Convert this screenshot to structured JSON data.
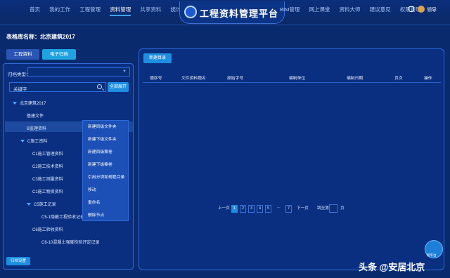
{
  "header": {
    "nav_left": [
      "首页",
      "我的工作",
      "工程管理",
      "资料管理",
      "共享资料",
      "统计分析"
    ],
    "active_index": 3,
    "app_title": "工程资料管理平台",
    "nav_right": [
      "BIM管理",
      "网上课堂",
      "资料大师",
      "建议意见",
      "权限管理"
    ],
    "user_name": "领导"
  },
  "form": {
    "form_lib_label": "表格库名称：北京建筑2017",
    "tabs": [
      "工程资料",
      "电子归档"
    ]
  },
  "left": {
    "archive_type_label": "归档类型：",
    "keyword_label": "关键字",
    "expand_all": "全部展开",
    "tree": [
      {
        "label": "北京建筑2017"
      },
      {
        "label": "基建文件"
      },
      {
        "label": "B监理资料"
      },
      {
        "label": "C施工资料"
      },
      {
        "label": "C1施工管理资料"
      },
      {
        "label": "C2施工技术资料"
      },
      {
        "label": "C3施工测量资料"
      },
      {
        "label": "C1施工物资资料"
      },
      {
        "label": "C5施工记录"
      },
      {
        "label": "C5-1隐蔽工程验收记录"
      },
      {
        "label": "C6施工验收资料"
      },
      {
        "label": "C6-10混凝土强度检验评定记录"
      }
    ],
    "context_menu": [
      "新建同级文件夹",
      "新建下级文件夹",
      "新建同级案卷",
      "新建下级案卷",
      "引用分项和规程目录",
      "移动",
      "重命名",
      "删除节点"
    ],
    "settings_button": "归档设置"
  },
  "right": {
    "new_dir": "新建目录",
    "columns": [
      "顺序号",
      "文件资料题名",
      "原始字号",
      "编制单位",
      "编制日期",
      "页次",
      "操作"
    ],
    "pager": {
      "prev": "上一页",
      "pages": [
        "1",
        "2",
        "3",
        "4",
        "5",
        "...",
        "7"
      ],
      "current": "1",
      "next": "下一页",
      "goto_prefix": "跳至第",
      "goto_suffix": "页"
    }
  },
  "float_button": "新平台",
  "watermark": "头条 @安居北京"
}
